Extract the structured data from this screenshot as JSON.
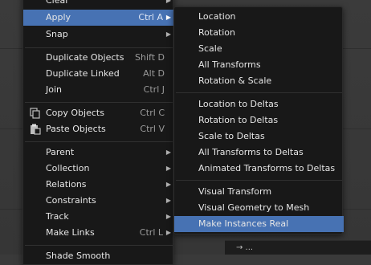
{
  "main_menu": {
    "items": [
      {
        "label": "Clear",
        "shortcut": "",
        "submenu": true
      },
      {
        "label": "Apply",
        "shortcut": "Ctrl A",
        "submenu": true
      },
      {
        "label": "Snap",
        "shortcut": "",
        "submenu": true
      },
      {
        "label": "Duplicate Objects",
        "shortcut": "Shift D",
        "submenu": false
      },
      {
        "label": "Duplicate Linked",
        "shortcut": "Alt D",
        "submenu": false
      },
      {
        "label": "Join",
        "shortcut": "Ctrl J",
        "submenu": false
      },
      {
        "label": "Copy Objects",
        "shortcut": "Ctrl C",
        "submenu": false,
        "icon": "copy-icon"
      },
      {
        "label": "Paste Objects",
        "shortcut": "Ctrl V",
        "submenu": false,
        "icon": "paste-icon"
      },
      {
        "label": "Parent",
        "shortcut": "",
        "submenu": true
      },
      {
        "label": "Collection",
        "shortcut": "",
        "submenu": true
      },
      {
        "label": "Relations",
        "shortcut": "",
        "submenu": true
      },
      {
        "label": "Constraints",
        "shortcut": "",
        "submenu": true
      },
      {
        "label": "Track",
        "shortcut": "",
        "submenu": true
      },
      {
        "label": "Make Links",
        "shortcut": "Ctrl L",
        "submenu": true
      },
      {
        "label": "Shade Smooth",
        "shortcut": "",
        "submenu": false
      }
    ],
    "highlighted_index": 1
  },
  "apply_submenu": {
    "items": [
      {
        "label": "Location"
      },
      {
        "label": "Rotation"
      },
      {
        "label": "Scale"
      },
      {
        "label": "All Transforms"
      },
      {
        "label": "Rotation & Scale"
      },
      {
        "label": "Location to Deltas"
      },
      {
        "label": "Rotation to Deltas"
      },
      {
        "label": "Scale to Deltas"
      },
      {
        "label": "All Transforms to Deltas"
      },
      {
        "label": "Animated Transforms to Deltas"
      },
      {
        "label": "Visual Transform"
      },
      {
        "label": "Visual Geometry to Mesh"
      },
      {
        "label": "Make Instances Real"
      }
    ],
    "highlighted_index": 12
  },
  "status_bar": {
    "text": "→ ..."
  },
  "colors": {
    "highlight": "#4772b3",
    "menu_bg": "#181818",
    "text": "#e6e6e6",
    "shortcut_text": "#9a9a9a"
  }
}
